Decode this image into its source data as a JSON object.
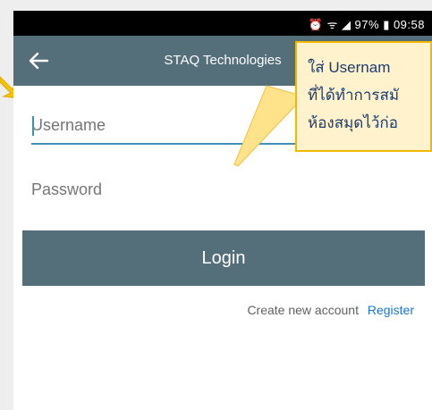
{
  "status_bar": {
    "indicators": "⏰ ᯤ ◢ 97% ▮ 09:58"
  },
  "app_bar": {
    "title": "STAQ Technologies",
    "back_icon": "arrow-left-icon"
  },
  "form": {
    "username_placeholder": "Username",
    "password_placeholder": "Password",
    "login_label": "Login"
  },
  "footer": {
    "create_text": "Create new account",
    "register_label": "Register"
  },
  "tooltip": {
    "lines": [
      "ใส่ Usernam",
      "ที่ได้ทำการสมั",
      "ห้องสมุดไว้ก่อ"
    ]
  },
  "colors": {
    "app_bar": "#546e7a",
    "accent": "#3f8fb7",
    "link": "#1976d2",
    "tooltip_bg": "#fff2cc",
    "tooltip_border": "#f0b800",
    "tooltip_text": "#1c3c70"
  }
}
